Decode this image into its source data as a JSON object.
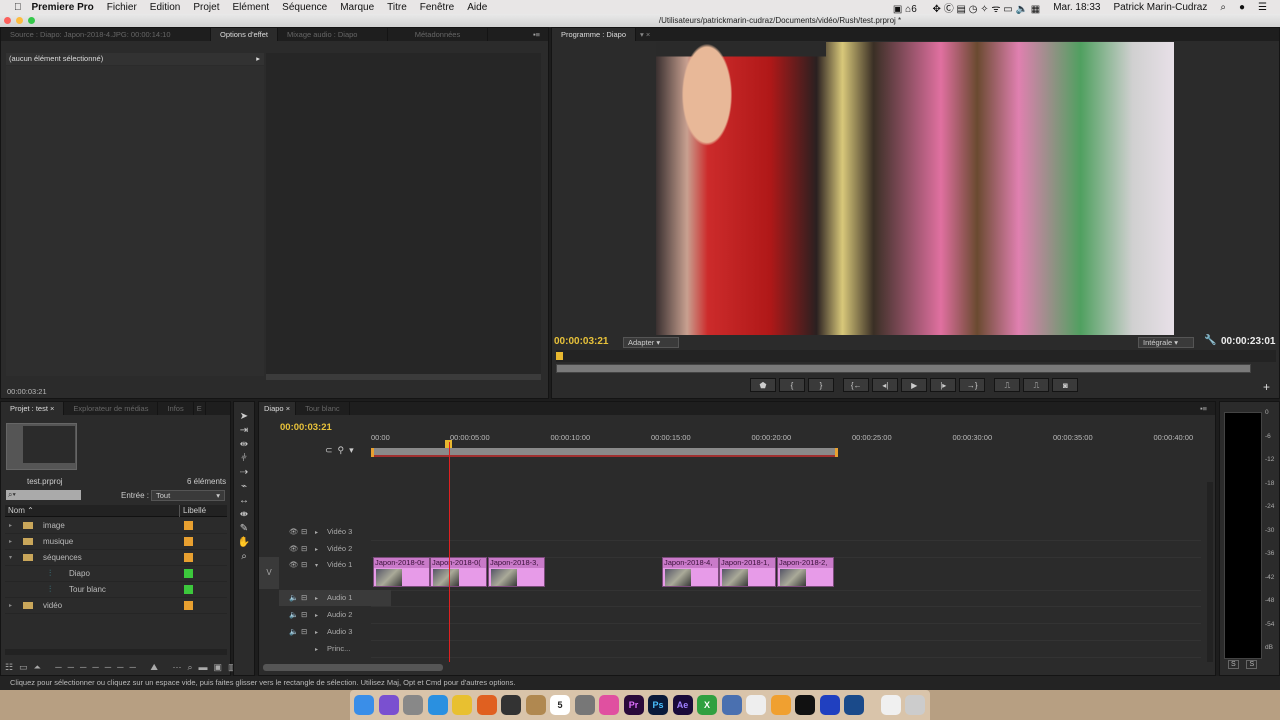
{
  "menubar": {
    "app": "Premiere Pro",
    "items": [
      "Fichier",
      "Edition",
      "Projet",
      "Elément",
      "Séquence",
      "Marque",
      "Titre",
      "Fenêtre",
      "Aide"
    ],
    "clock": "Mar. 18:33",
    "user": "Patrick Marin-Cudraz",
    "badge": "6"
  },
  "window": {
    "title": "/Utilisateurs/patrickmarin-cudraz/Documents/vidéo/Rush/test.prproj *"
  },
  "source_panel": {
    "tabs": [
      "Source : Diapo: Japon-2018-4.JPG: 00:00:14:10",
      "Options d'effet",
      "Mixage audio : Diapo",
      "Métadonnées"
    ],
    "no_selection": "(aucun élément sélectionné)",
    "timecode": "00:00:03:21"
  },
  "program_panel": {
    "tab": "Programme : Diapo",
    "timecode": "00:00:03:21",
    "fit": "Adapter",
    "quality": "Intégrale",
    "duration": "00:00:23:01"
  },
  "project_panel": {
    "tabs": [
      "Projet : test",
      "Explorateur de médias",
      "Infos",
      "E"
    ],
    "file": "test.prproj",
    "count": "6 éléments",
    "entry_label": "Entrée :",
    "entry_value": "Tout",
    "col_name": "Nom",
    "col_label": "Libellé",
    "items": [
      {
        "name": "image",
        "type": "folder",
        "expanded": false,
        "indent": 0,
        "color": "#e8a030"
      },
      {
        "name": "musique",
        "type": "folder",
        "expanded": false,
        "indent": 0,
        "color": "#e8a030"
      },
      {
        "name": "séquences",
        "type": "folder",
        "expanded": true,
        "indent": 0,
        "color": "#e8a030"
      },
      {
        "name": "Diapo",
        "type": "sequence",
        "indent": 1,
        "color": "#3cc83c"
      },
      {
        "name": "Tour blanc",
        "type": "sequence",
        "indent": 1,
        "color": "#3cc83c"
      },
      {
        "name": "vidéo",
        "type": "folder",
        "expanded": false,
        "indent": 0,
        "color": "#e8a030"
      }
    ]
  },
  "timeline": {
    "tabs": [
      "Diapo",
      "Tour blanc"
    ],
    "timecode": "00:00:03:21",
    "ruler": [
      "00:00",
      "00:00:05:00",
      "00:00:10:00",
      "00:00:15:00",
      "00:00:20:00",
      "00:00:25:00",
      "00:00:30:00",
      "00:00:35:00",
      "00:00:40:00"
    ],
    "tracks": [
      "Vidéo 3",
      "Vidéo 2",
      "Vidéo 1",
      "Audio 1",
      "Audio 2",
      "Audio 3",
      "Princ..."
    ],
    "target": "V",
    "clips": [
      "Japon-2018-0ε",
      "Japon-2018-0(",
      "Japon-2018-3,",
      "Japon-2018-4,",
      "Japon-2018-1,",
      "Japon-2018-2,"
    ]
  },
  "meter": {
    "scale": [
      "0",
      "-6",
      "-12",
      "-18",
      "-24",
      "-30",
      "-36",
      "-42",
      "-48",
      "-54",
      "dB"
    ],
    "solo": [
      "S",
      "S"
    ]
  },
  "status": "Cliquez pour sélectionner ou cliquez sur un espace vide, puis faites glisser vers le rectangle de sélection. Utilisez Maj, Opt et Cmd pour d'autres options.",
  "dock": [
    "Finder",
    "Siri",
    "Launchpad",
    "Safari",
    "Chrome",
    "Firefox",
    "Calc",
    "Notes",
    "Calendar",
    "Prefs",
    "iTunes",
    "Pr",
    "Ps",
    "Ae",
    "X",
    "Preview",
    "Photos",
    "Photos2",
    "QuickTime",
    "iPhoto",
    "Q",
    "Doc",
    "Trash"
  ],
  "calendar_day": "5"
}
